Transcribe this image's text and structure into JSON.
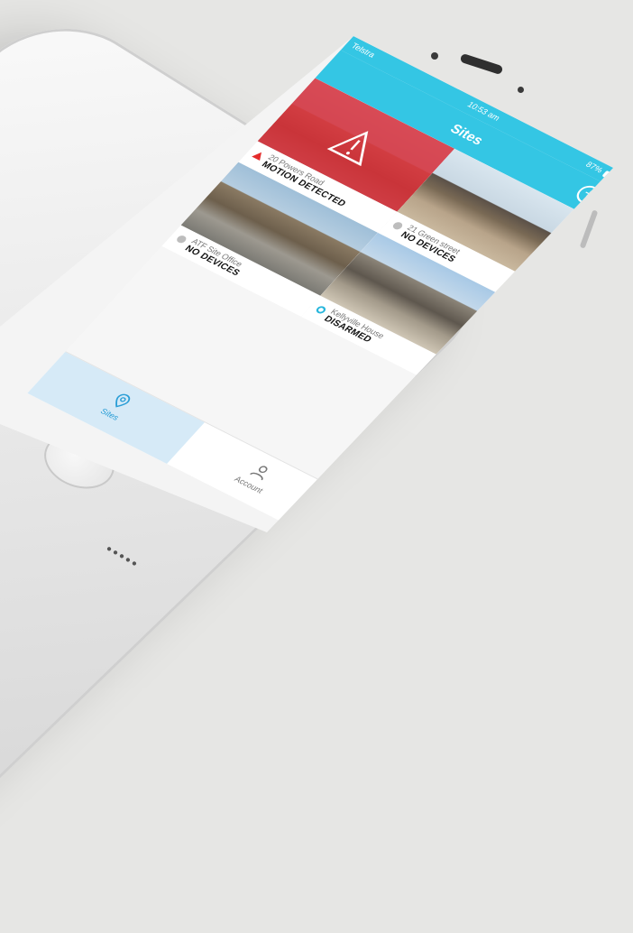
{
  "status_bar": {
    "carrier": "Telstra",
    "time": "10:53 am",
    "battery": "87%"
  },
  "nav": {
    "title": "Sites",
    "add_icon": "plus-circle-icon"
  },
  "sites": [
    {
      "name": "20 Powers Road",
      "status": "MOTION DETECTED",
      "marker": "alert-triangle",
      "alert": true
    },
    {
      "name": "21 Green street",
      "status": "NO DEVICES",
      "marker": "gray-dot",
      "alert": false
    },
    {
      "name": "ATF Site Office",
      "status": "NO DEVICES",
      "marker": "gray-dot",
      "alert": false
    },
    {
      "name": "Kellyville House",
      "status": "DISARMED",
      "marker": "blue-ring",
      "alert": false
    }
  ],
  "tabs": [
    {
      "label": "Sites",
      "icon": "location-pin-icon",
      "active": true
    },
    {
      "label": "Account",
      "icon": "user-icon",
      "active": false
    }
  ],
  "colors": {
    "accent": "#34c6e4",
    "alert": "#de2c36",
    "tab_active_bg": "#d6eaf7"
  }
}
